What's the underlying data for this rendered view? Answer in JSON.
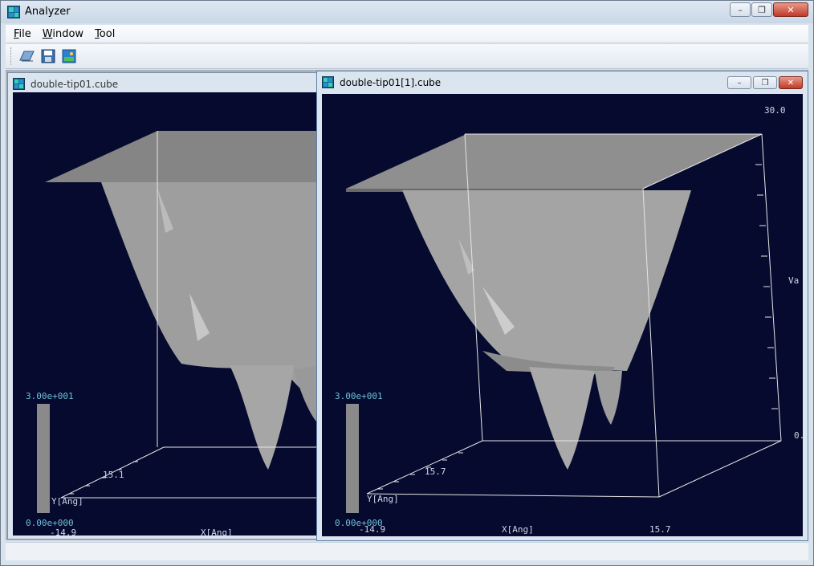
{
  "app": {
    "title": "Analyzer",
    "window_controls": {
      "minimize": "–",
      "restore": "❐",
      "close": "✕"
    }
  },
  "menu": [
    "File",
    "Window",
    "Tool"
  ],
  "toolbar": {
    "buttons": [
      {
        "name": "open-icon"
      },
      {
        "name": "save-icon"
      },
      {
        "name": "image-icon"
      }
    ]
  },
  "windows": [
    {
      "title": "double-tip01.cube",
      "colorbar": {
        "max": "3.00e+001",
        "min": "0.00e+000"
      },
      "axes": {
        "y_label": "Y[Ang]",
        "x_label": "X[Ang]",
        "y_tick": "15.1",
        "x_tick": "-14.9"
      }
    },
    {
      "title": "double-tip01[1].cube",
      "colorbar": {
        "max": "3.00e+001",
        "min": "0.00e+000"
      },
      "axes": {
        "y_label": "Y[Ang]",
        "x_label": "X[Ang]",
        "y_tick": "15.7",
        "x_tick_min": "-14.9",
        "x_tick_max": "15.7",
        "z_max": "30.0",
        "z_min": "0.",
        "z_label": "Va"
      }
    }
  ],
  "colors": {
    "viewport_bg": "#050a2e",
    "surface": "#9a9a9a",
    "colorbar_text": "#6ec0d8"
  }
}
